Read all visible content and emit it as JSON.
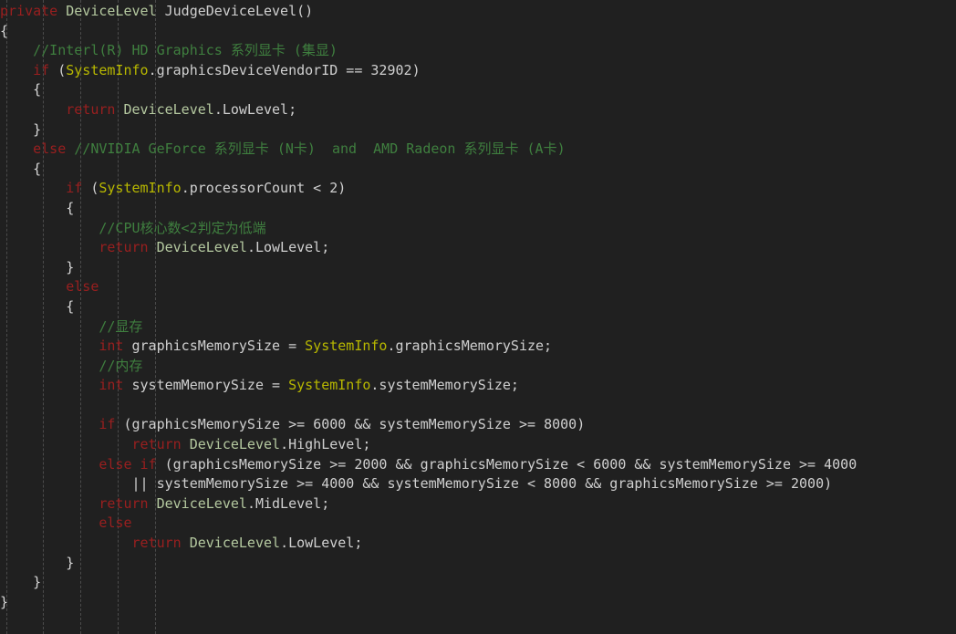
{
  "editor": {
    "language": "C#",
    "background_color": "#202020",
    "font_size_px": 15,
    "line_height_px": 21.6,
    "colors": {
      "background": "#202020",
      "plain_text": "#d0d0d0",
      "keyword": "#9a1f1f",
      "comment": "#3f7f3f",
      "type_name": "#b5c9a0",
      "class_static": "#b8b800",
      "indent_guide": "#5a5a5a"
    },
    "indent_guides_x": [
      7,
      47,
      88,
      129,
      170
    ]
  },
  "code": {
    "full_text": "private DeviceLevel JudgeDeviceLevel()\n{\n    //Interl(R) HD Graphics 系列显卡 (集显)\n    if (SystemInfo.graphicsDeviceVendorID == 32902)\n    {\n        return DeviceLevel.LowLevel;\n    }\n    else //NVIDIA GeForce 系列显卡 (N卡)  and  AMD Radeon 系列显卡 (A卡)\n    {\n        if (SystemInfo.processorCount < 2)\n        {\n            //CPU核心数<2判定为低端\n            return DeviceLevel.LowLevel;\n        }\n        else\n        {\n            //显存\n            int graphicsMemorySize = SystemInfo.graphicsMemorySize;\n            //内存\n            int systemMemorySize = SystemInfo.systemMemorySize;\n\n            if (graphicsMemorySize >= 6000 && systemMemorySize >= 8000)\n                return DeviceLevel.HighLevel;\n            else if (graphicsMemorySize >= 2000 && graphicsMemorySize < 6000 && systemMemorySize >= 4000\n                || systemMemorySize >= 4000 && systemMemorySize < 8000 && graphicsMemorySize >= 2000)\n                return DeviceLevel.MidLevel;\n            else\n                return DeviceLevel.LowLevel;\n        }\n    }\n}",
    "lines": [
      {
        "n": 1,
        "tokens": [
          {
            "t": "private",
            "c": "keyword"
          },
          {
            "t": " ",
            "c": "plain"
          },
          {
            "t": "DeviceLevel",
            "c": "type"
          },
          {
            "t": " JudgeDeviceLevel()",
            "c": "plain"
          }
        ]
      },
      {
        "n": 2,
        "tokens": [
          {
            "t": "{",
            "c": "brace"
          }
        ]
      },
      {
        "n": 3,
        "tokens": [
          {
            "t": "    ",
            "c": "plain"
          },
          {
            "t": "//Interl(R) HD Graphics 系列显卡 (集显)",
            "c": "comment"
          }
        ]
      },
      {
        "n": 4,
        "tokens": [
          {
            "t": "    ",
            "c": "plain"
          },
          {
            "t": "if",
            "c": "keyword"
          },
          {
            "t": " (",
            "c": "plain"
          },
          {
            "t": "SystemInfo",
            "c": "class"
          },
          {
            "t": ".graphicsDeviceVendorID == ",
            "c": "plain"
          },
          {
            "t": "32902",
            "c": "number"
          },
          {
            "t": ")",
            "c": "plain"
          }
        ]
      },
      {
        "n": 5,
        "tokens": [
          {
            "t": "    ",
            "c": "plain"
          },
          {
            "t": "{",
            "c": "brace"
          }
        ]
      },
      {
        "n": 6,
        "tokens": [
          {
            "t": "        ",
            "c": "plain"
          },
          {
            "t": "return",
            "c": "keyword"
          },
          {
            "t": " ",
            "c": "plain"
          },
          {
            "t": "DeviceLevel",
            "c": "type"
          },
          {
            "t": ".LowLevel;",
            "c": "plain"
          }
        ]
      },
      {
        "n": 7,
        "tokens": [
          {
            "t": "    ",
            "c": "plain"
          },
          {
            "t": "}",
            "c": "brace"
          }
        ]
      },
      {
        "n": 8,
        "tokens": [
          {
            "t": "    ",
            "c": "plain"
          },
          {
            "t": "else",
            "c": "keyword"
          },
          {
            "t": " ",
            "c": "plain"
          },
          {
            "t": "//NVIDIA GeForce 系列显卡 (N卡)  and  AMD Radeon 系列显卡 (A卡)",
            "c": "comment"
          }
        ]
      },
      {
        "n": 9,
        "tokens": [
          {
            "t": "    ",
            "c": "plain"
          },
          {
            "t": "{",
            "c": "brace"
          }
        ]
      },
      {
        "n": 10,
        "tokens": [
          {
            "t": "        ",
            "c": "plain"
          },
          {
            "t": "if",
            "c": "keyword"
          },
          {
            "t": " (",
            "c": "plain"
          },
          {
            "t": "SystemInfo",
            "c": "class"
          },
          {
            "t": ".processorCount < ",
            "c": "plain"
          },
          {
            "t": "2",
            "c": "number"
          },
          {
            "t": ")",
            "c": "plain"
          }
        ]
      },
      {
        "n": 11,
        "tokens": [
          {
            "t": "        ",
            "c": "plain"
          },
          {
            "t": "{",
            "c": "brace"
          }
        ]
      },
      {
        "n": 12,
        "tokens": [
          {
            "t": "            ",
            "c": "plain"
          },
          {
            "t": "//CPU核心数<2判定为低端",
            "c": "comment"
          }
        ]
      },
      {
        "n": 13,
        "tokens": [
          {
            "t": "            ",
            "c": "plain"
          },
          {
            "t": "return",
            "c": "keyword"
          },
          {
            "t": " ",
            "c": "plain"
          },
          {
            "t": "DeviceLevel",
            "c": "type"
          },
          {
            "t": ".LowLevel;",
            "c": "plain"
          }
        ]
      },
      {
        "n": 14,
        "tokens": [
          {
            "t": "        ",
            "c": "plain"
          },
          {
            "t": "}",
            "c": "brace"
          }
        ]
      },
      {
        "n": 15,
        "tokens": [
          {
            "t": "        ",
            "c": "plain"
          },
          {
            "t": "else",
            "c": "keyword"
          }
        ]
      },
      {
        "n": 16,
        "tokens": [
          {
            "t": "        ",
            "c": "plain"
          },
          {
            "t": "{",
            "c": "brace"
          }
        ]
      },
      {
        "n": 17,
        "tokens": [
          {
            "t": "            ",
            "c": "plain"
          },
          {
            "t": "//显存",
            "c": "comment"
          }
        ]
      },
      {
        "n": 18,
        "tokens": [
          {
            "t": "            ",
            "c": "plain"
          },
          {
            "t": "int",
            "c": "keyword"
          },
          {
            "t": " graphicsMemorySize = ",
            "c": "plain"
          },
          {
            "t": "SystemInfo",
            "c": "class"
          },
          {
            "t": ".graphicsMemorySize;",
            "c": "plain"
          }
        ]
      },
      {
        "n": 19,
        "tokens": [
          {
            "t": "            ",
            "c": "plain"
          },
          {
            "t": "//内存",
            "c": "comment"
          }
        ]
      },
      {
        "n": 20,
        "tokens": [
          {
            "t": "            ",
            "c": "plain"
          },
          {
            "t": "int",
            "c": "keyword"
          },
          {
            "t": " systemMemorySize = ",
            "c": "plain"
          },
          {
            "t": "SystemInfo",
            "c": "class"
          },
          {
            "t": ".systemMemorySize;",
            "c": "plain"
          }
        ]
      },
      {
        "n": 21,
        "tokens": []
      },
      {
        "n": 22,
        "tokens": [
          {
            "t": "            ",
            "c": "plain"
          },
          {
            "t": "if",
            "c": "keyword"
          },
          {
            "t": " (graphicsMemorySize >= ",
            "c": "plain"
          },
          {
            "t": "6000",
            "c": "number"
          },
          {
            "t": " && systemMemorySize >= ",
            "c": "plain"
          },
          {
            "t": "8000",
            "c": "number"
          },
          {
            "t": ")",
            "c": "plain"
          }
        ]
      },
      {
        "n": 23,
        "tokens": [
          {
            "t": "                ",
            "c": "plain"
          },
          {
            "t": "return",
            "c": "keyword"
          },
          {
            "t": " ",
            "c": "plain"
          },
          {
            "t": "DeviceLevel",
            "c": "type"
          },
          {
            "t": ".HighLevel;",
            "c": "plain"
          }
        ]
      },
      {
        "n": 24,
        "tokens": [
          {
            "t": "            ",
            "c": "plain"
          },
          {
            "t": "else",
            "c": "keyword"
          },
          {
            "t": " ",
            "c": "plain"
          },
          {
            "t": "if",
            "c": "keyword"
          },
          {
            "t": " (graphicsMemorySize >= ",
            "c": "plain"
          },
          {
            "t": "2000",
            "c": "number"
          },
          {
            "t": " && graphicsMemorySize < ",
            "c": "plain"
          },
          {
            "t": "6000",
            "c": "number"
          },
          {
            "t": " && systemMemorySize >= ",
            "c": "plain"
          },
          {
            "t": "4000",
            "c": "number"
          }
        ]
      },
      {
        "n": 25,
        "tokens": [
          {
            "t": "                || systemMemorySize >= ",
            "c": "plain"
          },
          {
            "t": "4000",
            "c": "number"
          },
          {
            "t": " && systemMemorySize < ",
            "c": "plain"
          },
          {
            "t": "8000",
            "c": "number"
          },
          {
            "t": " && graphicsMemorySize >= ",
            "c": "plain"
          },
          {
            "t": "2000",
            "c": "number"
          },
          {
            "t": ")",
            "c": "plain"
          }
        ]
      },
      {
        "n": 26,
        "tokens": [
          {
            "t": "            ",
            "c": "plain"
          },
          {
            "t": "return",
            "c": "keyword"
          },
          {
            "t": " ",
            "c": "plain"
          },
          {
            "t": "DeviceLevel",
            "c": "type"
          },
          {
            "t": ".MidLevel;",
            "c": "plain"
          }
        ]
      },
      {
        "n": 27,
        "tokens": [
          {
            "t": "            ",
            "c": "plain"
          },
          {
            "t": "else",
            "c": "keyword"
          }
        ]
      },
      {
        "n": 28,
        "tokens": [
          {
            "t": "                ",
            "c": "plain"
          },
          {
            "t": "return",
            "c": "keyword"
          },
          {
            "t": " ",
            "c": "plain"
          },
          {
            "t": "DeviceLevel",
            "c": "type"
          },
          {
            "t": ".LowLevel;",
            "c": "plain"
          }
        ]
      },
      {
        "n": 29,
        "tokens": [
          {
            "t": "        ",
            "c": "plain"
          },
          {
            "t": "}",
            "c": "brace"
          }
        ]
      },
      {
        "n": 30,
        "tokens": [
          {
            "t": "    ",
            "c": "plain"
          },
          {
            "t": "}",
            "c": "brace"
          }
        ]
      },
      {
        "n": 31,
        "tokens": [
          {
            "t": "}",
            "c": "brace"
          }
        ]
      }
    ]
  }
}
